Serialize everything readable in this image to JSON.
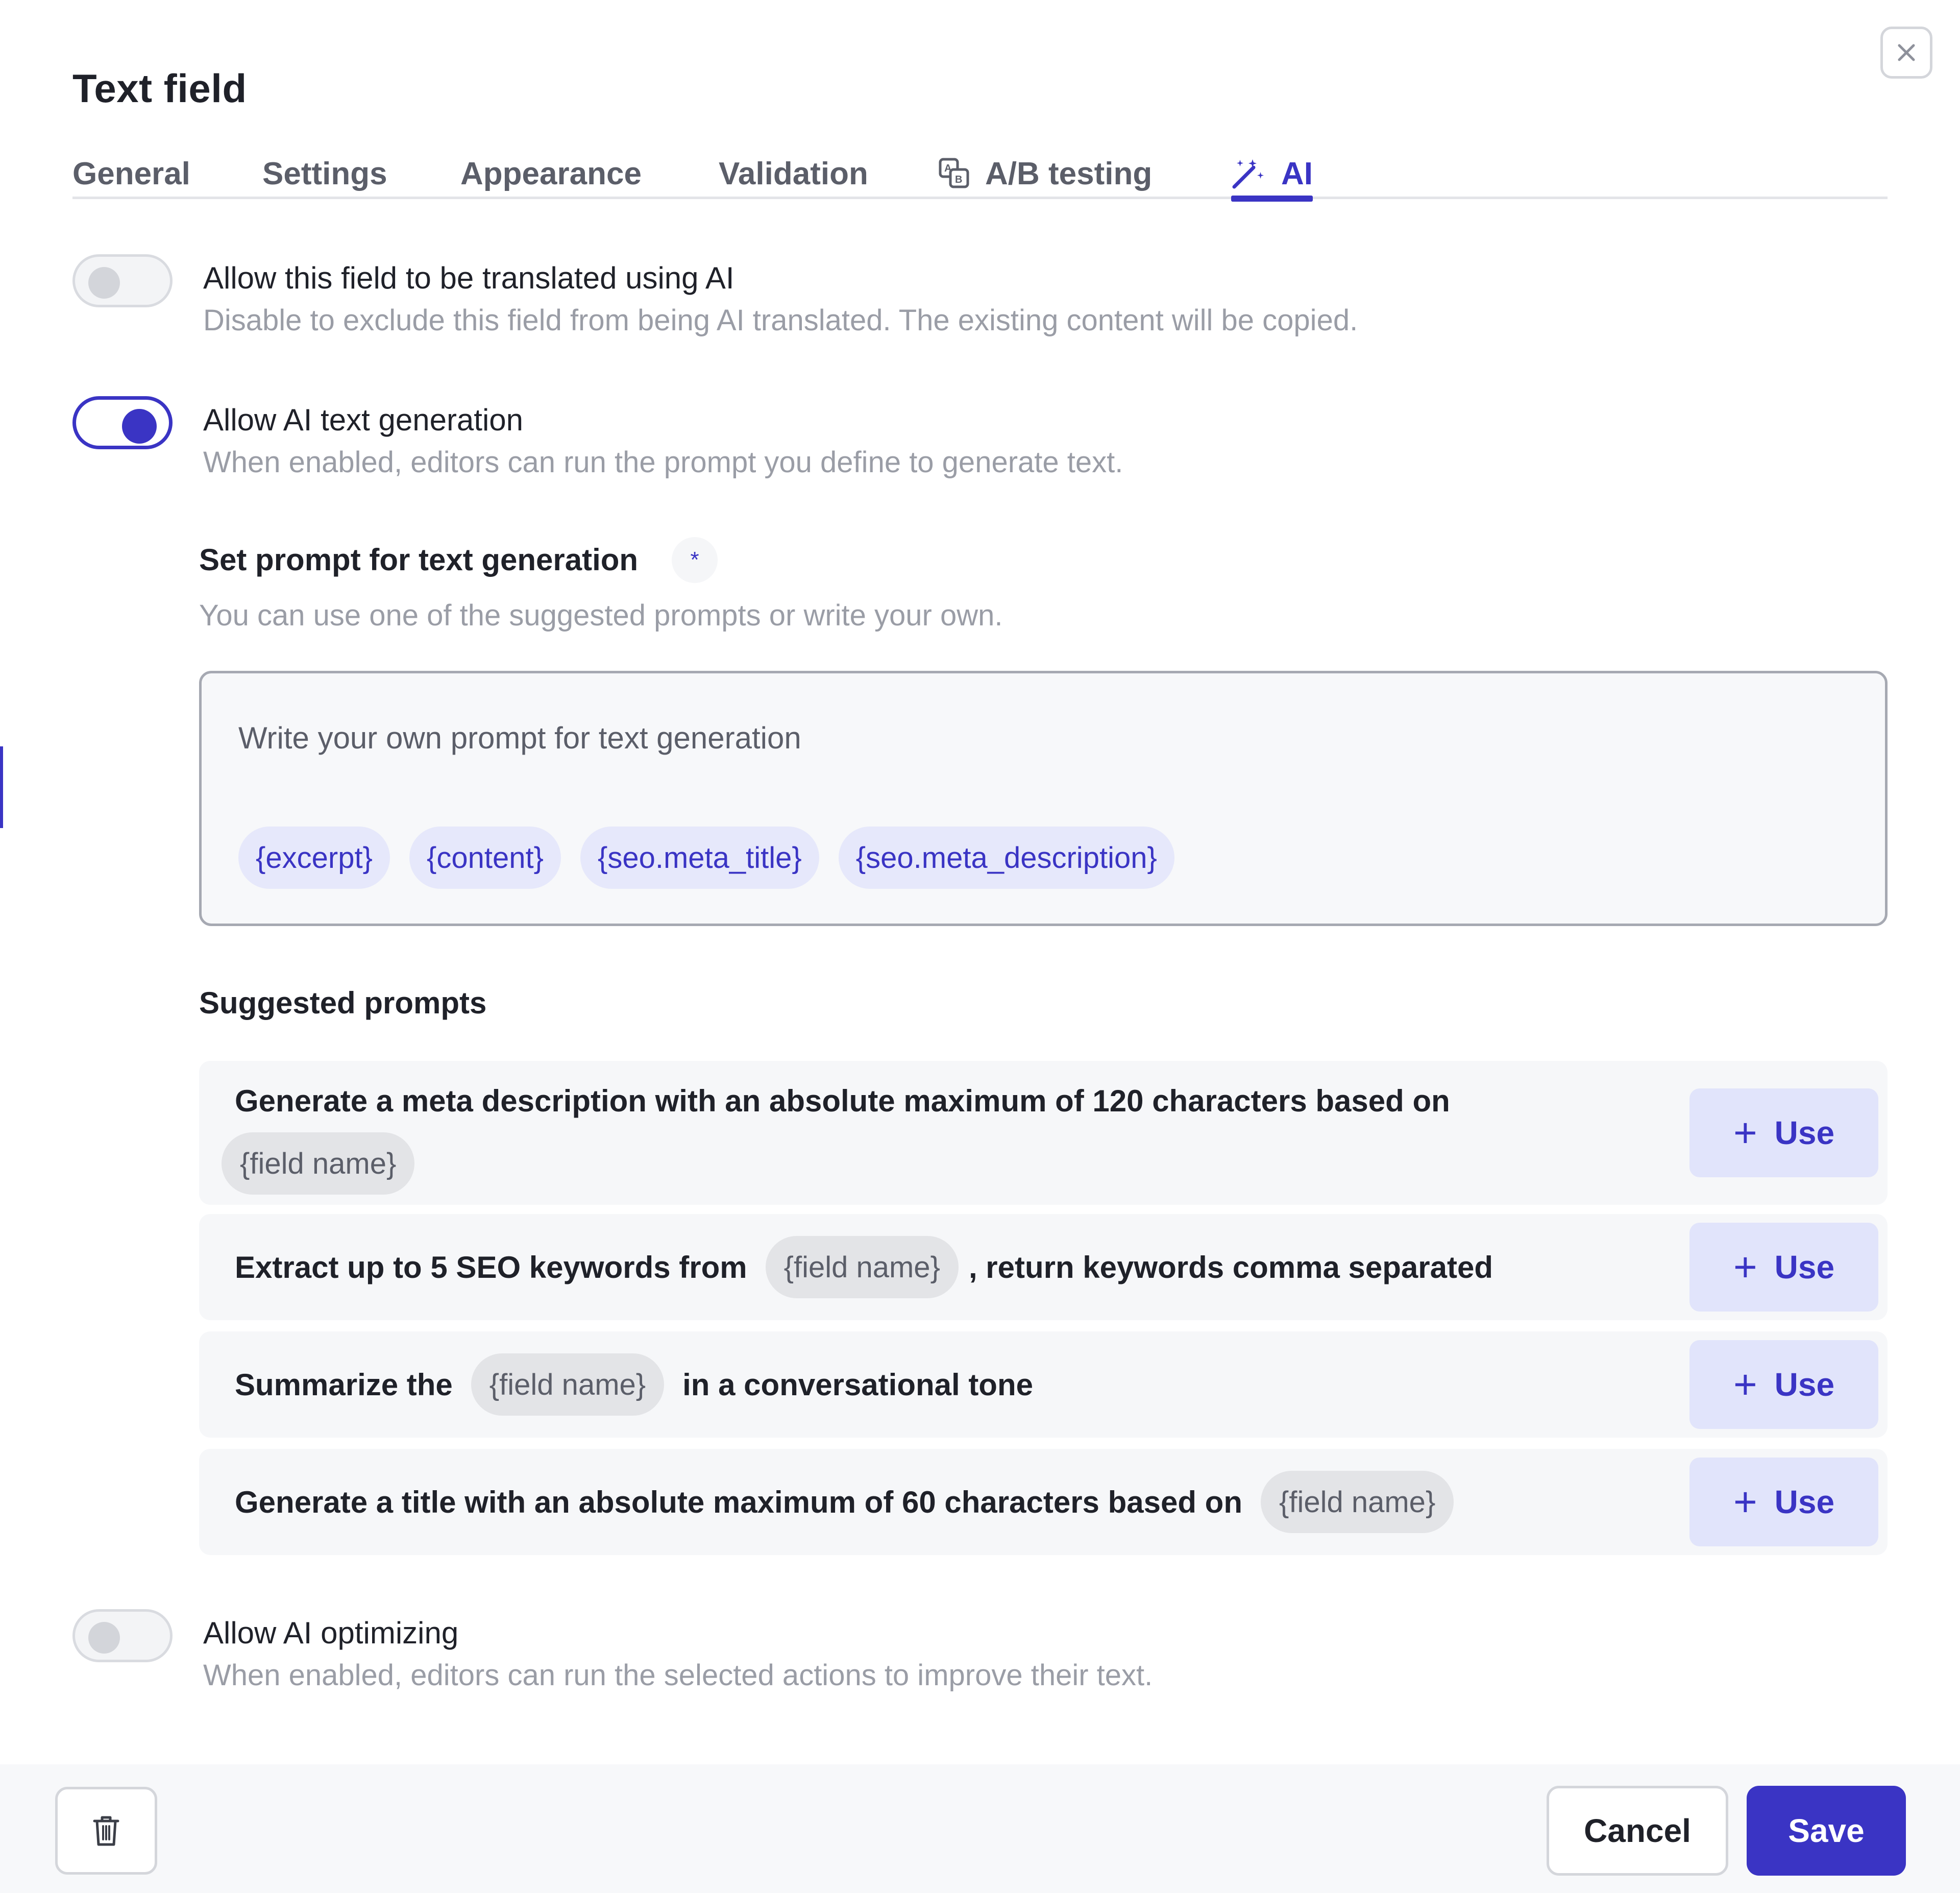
{
  "dialog": {
    "title": "Text field",
    "close_icon": "close-icon"
  },
  "tabs": [
    {
      "label": "General",
      "active": false
    },
    {
      "label": "Settings",
      "active": false
    },
    {
      "label": "Appearance",
      "active": false
    },
    {
      "label": "Validation",
      "active": false
    },
    {
      "label": "A/B testing",
      "active": false,
      "icon": "ab-testing-icon"
    },
    {
      "label": "AI",
      "active": true,
      "icon": "magic-wand-icon"
    }
  ],
  "options": {
    "translate": {
      "label": "Allow this field to be translated using AI",
      "description": "Disable to exclude this field from being AI translated. The existing content will be copied.",
      "enabled": false
    },
    "generation": {
      "label": "Allow AI text generation",
      "description": "When enabled, editors can run the prompt you define to generate text.",
      "enabled": true
    },
    "optimizing": {
      "label": "Allow AI optimizing",
      "description": "When enabled, editors can run the selected actions to improve their text.",
      "enabled": false
    }
  },
  "prompt": {
    "title": "Set prompt for text generation",
    "required_marker": "*",
    "hint": "You can use one of the suggested prompts or write your own.",
    "placeholder": "Write your own prompt for text generation",
    "variables": [
      "{excerpt}",
      "{content}",
      "{seo.meta_title}",
      "{seo.meta_description}"
    ]
  },
  "suggested": {
    "title": "Suggested prompts",
    "use_label": "Use",
    "field_chip": "{field name}",
    "items": [
      {
        "before": "Generate a meta description with an absolute maximum of 120 characters based on",
        "after": ""
      },
      {
        "before": "Extract up to 5 SEO keywords from",
        "after": ", return keywords comma separated"
      },
      {
        "before": "Summarize the",
        "after": "in a conversational tone"
      },
      {
        "before": "Generate a title with an absolute maximum of 60 characters based on",
        "after": ""
      }
    ]
  },
  "footer": {
    "delete_icon": "trash-icon",
    "cancel_label": "Cancel",
    "save_label": "Save"
  },
  "colors": {
    "accent": "#3a34c4",
    "chip_bg": "#e6e8fb",
    "muted_text": "#9a9da6"
  }
}
